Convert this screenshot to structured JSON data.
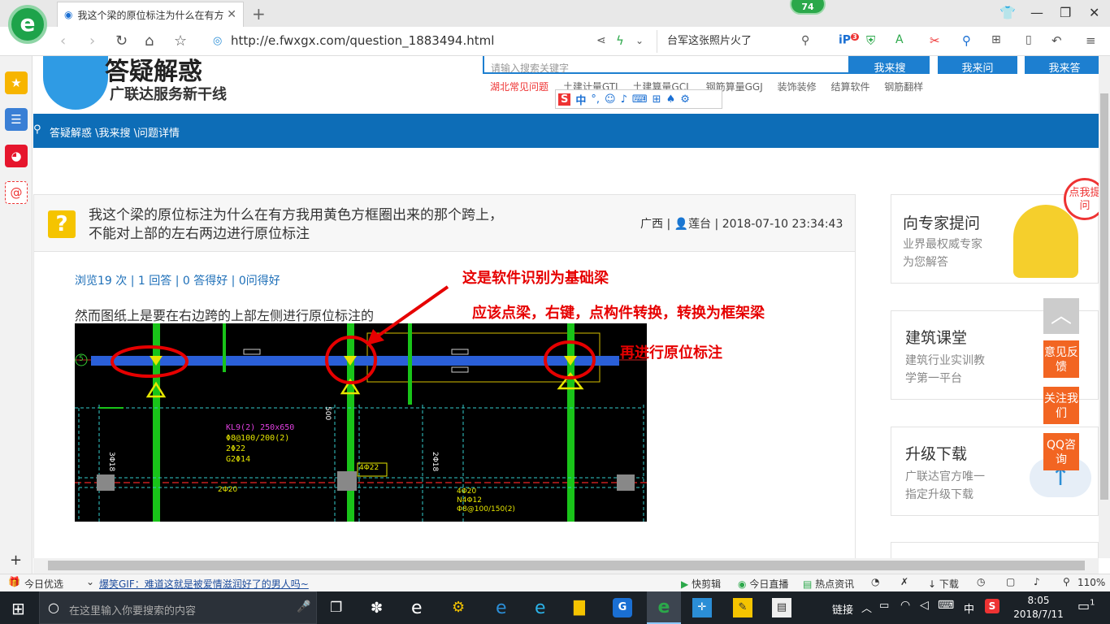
{
  "browser": {
    "tab_title": "我这个梁的原位标注为什么在有方",
    "url": "http://e.fwxgx.com/question_1883494.html",
    "search_text": "台军这张照片火了",
    "badge_74": "74",
    "ext_badge": "3"
  },
  "site": {
    "logo_title": "答疑解惑",
    "logo_subtitle": "广联达服务新干线",
    "search_placeholder": "请输入搜索关键字",
    "btn_search": "我来搜",
    "btn_ask": "我来问",
    "btn_answer": "我来答",
    "hot_links": [
      "湖北常见问题",
      "土建计量GTJ",
      "土建算量GCL",
      "钢筋算量GGJ",
      "装饰装修",
      "结算软件",
      "钢筋翻样"
    ],
    "ime_label": "中",
    "breadcrumb": "答疑解惑 \\我来搜 \\问题详情"
  },
  "question": {
    "title_line1": "我这个梁的原位标注为什么在有方我用黄色方框圈出来的那个跨上，",
    "title_line2": "不能对上部的左右两边进行原位标注",
    "region": "广西",
    "user": "莲台",
    "datetime": "2018-07-10 23:34:43",
    "stats": "浏览19 次 | 1 回答 | 0 答得好 | 0问得好",
    "body": "然而图纸上是要在右边跨的上部左侧进行原位标注的"
  },
  "annotations": {
    "a1": "这是软件识别为基础梁",
    "a2": "应该点梁，右键，点构件转换，转换为框架梁",
    "a3": "再进行原位标注"
  },
  "cad": {
    "label_5": "5",
    "beam_name": "KL9(2) 250x650",
    "stirrup": "Φ8@100/200(2)",
    "top_bar": "2Φ22",
    "side_bar": "G2Φ14",
    "bar_4_22": "4Φ22",
    "bar_2_20": "2Φ20",
    "bar_4_20": "4Φ20",
    "bar_n4": "N4Φ12",
    "stirrup2": "Φ8@100/150(2)",
    "bar_3_18": "3Φ18",
    "bar_2_18": "2Φ18",
    "dim_500": "500"
  },
  "sidebar": {
    "cards": [
      {
        "title": "向专家提问",
        "sub1": "业界最权威专家",
        "sub2": "为您解答"
      },
      {
        "title": "建筑课堂",
        "sub1": "建筑行业实训教",
        "sub2": "学第一平台"
      },
      {
        "title": "升级下载",
        "sub1": "广联达官方唯一",
        "sub2": "指定升级下载"
      }
    ],
    "float_ask": "点我提问",
    "float_feedback": "意见反馈",
    "float_follow": "关注我们",
    "float_qq": "QQ咨询"
  },
  "statusbar": {
    "today": "今日优选",
    "news": "爆笑GIF：难道这就是被爱情滋润好了的男人吗~",
    "quickcut": "快剪辑",
    "live": "今日直播",
    "hot": "热点资讯",
    "download": "下载",
    "zoom": "110%"
  },
  "taskbar": {
    "search_placeholder": "在这里输入你要搜索的内容",
    "link": "链接",
    "ime": "中",
    "time": "8:05",
    "date": "2018/7/11",
    "notif": "1"
  },
  "colors": {
    "primary_blue": "#0d6db7",
    "orange": "#f26522",
    "annotation_red": "#e60000"
  }
}
